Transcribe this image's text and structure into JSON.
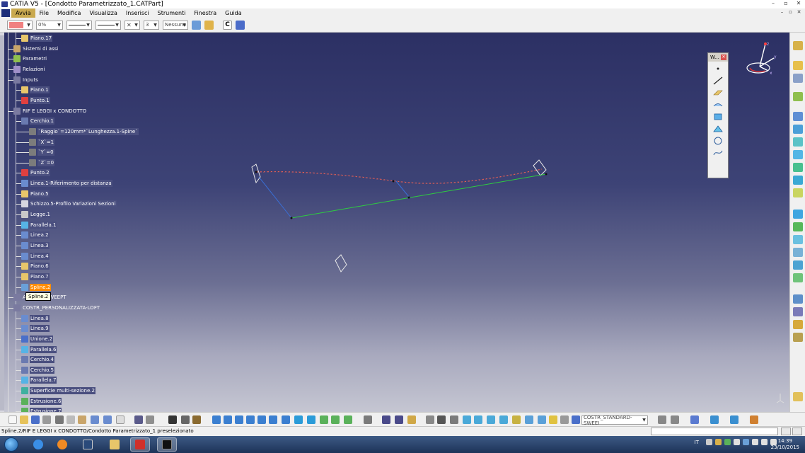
{
  "window": {
    "title": "CATIA V5 - [Condotto Parametrizzato_1.CATPart]",
    "buttons": [
      "–",
      "▫",
      "✕"
    ],
    "mdi_buttons": [
      "–",
      "▫",
      "✕"
    ]
  },
  "menu": {
    "items": [
      "Avvia",
      "File",
      "Modifica",
      "Visualizza",
      "Inserisci",
      "Strumenti",
      "Finestra",
      "Guida"
    ]
  },
  "properties_toolbar": {
    "transparency": "0%",
    "line_weight": "3",
    "layer": "Nessuno",
    "color_hex": "#f08080"
  },
  "tree": {
    "items": [
      {
        "label": "Piano.17",
        "icon": "plane-icon"
      },
      {
        "label": "Sistemi di assi",
        "icon": "axis-system-icon"
      },
      {
        "label": "Parametri",
        "icon": "parameters-icon"
      },
      {
        "label": "Relazioni",
        "icon": "relations-icon"
      },
      {
        "label": "Inputs",
        "icon": "geometrical-set-icon"
      },
      {
        "label": "Piano.1",
        "icon": "plane-icon"
      },
      {
        "label": "Punto.1",
        "icon": "point-icon"
      },
      {
        "label": "RIF E LEGGI x CONDOTTO",
        "icon": "geometrical-set-icon"
      },
      {
        "label": "Cerchio.1",
        "icon": "circle-icon"
      },
      {
        "label": "`Raggio`=120mm*`Lunghezza.1-Spine`",
        "icon": "formula-icon"
      },
      {
        "label": "`X`=1",
        "icon": "formula-icon"
      },
      {
        "label": "`Y`=0",
        "icon": "formula-icon"
      },
      {
        "label": "`Z`=0",
        "icon": "formula-icon"
      },
      {
        "label": "Punto.2",
        "icon": "point-icon"
      },
      {
        "label": "Linea.1-Riferimento per distanza",
        "icon": "line-icon"
      },
      {
        "label": "Piano.5",
        "icon": "plane-icon"
      },
      {
        "label": "Schizzo.5-Profilo Variazioni Sezioni",
        "icon": "sketch-icon"
      },
      {
        "label": "Legge.1",
        "icon": "law-icon"
      },
      {
        "label": "Parallela.1",
        "icon": "parallel-curve-icon"
      },
      {
        "label": "Linea.2",
        "icon": "line-icon"
      },
      {
        "label": "Linea.3",
        "icon": "line-icon"
      },
      {
        "label": "Linea.4",
        "icon": "line-icon"
      },
      {
        "label": "Piano.6",
        "icon": "plane-icon"
      },
      {
        "label": "Piano.7",
        "icon": "plane-icon"
      },
      {
        "label": "Spline.2",
        "icon": "spline-icon"
      },
      {
        "label": "ANDARD-SWEEPT",
        "icon": "geometrical-set-icon"
      },
      {
        "label": "COSTR_PERSONALIZZATA-LOFT",
        "icon": "geometrical-set-icon"
      },
      {
        "label": "Linea.8",
        "icon": "line-icon"
      },
      {
        "label": "Linea.9",
        "icon": "line-icon"
      },
      {
        "label": "Unione.2",
        "icon": "join-icon"
      },
      {
        "label": "Parallela.6",
        "icon": "parallel-curve-icon"
      },
      {
        "label": "Cerchio.4",
        "icon": "circle-icon"
      },
      {
        "label": "Cerchio.5",
        "icon": "circle-icon"
      },
      {
        "label": "Parallela.7",
        "icon": "parallel-curve-icon"
      },
      {
        "label": "Superficie multi-sezione.2",
        "icon": "multi-section-surface-icon"
      },
      {
        "label": "Estrusione.6",
        "icon": "extrude-icon"
      },
      {
        "label": "Estrusione.7",
        "icon": "extrude-icon"
      }
    ],
    "tooltip": "Spline.2"
  },
  "floating_toolbar": {
    "title": "W..."
  },
  "compass": {
    "axes": [
      "x",
      "y",
      "z"
    ]
  },
  "bottom_toolbar": {
    "current_set": "COSTR_STANDARD-SWEEI"
  },
  "status_bar": {
    "message": "Spline.2/RIF E LEGGI x CONDOTTO/Condotto Parametrizzato_1 preselezionato"
  },
  "taskbar": {
    "language": "IT",
    "time": "14:39",
    "date": "23/10/2015",
    "apps": [
      "start-orb",
      "ie-icon",
      "media-player-icon",
      "desktop-icon",
      "explorer-icon",
      "autocad-icon",
      "catia-icon"
    ]
  },
  "colors": {
    "viewport_top": "#2c3064",
    "viewport_bottom": "#c5c6d2",
    "selection": "#ff8c00",
    "spline": "#d95b5b",
    "green_line": "#2ecc40",
    "blue_line": "#3a6fd6"
  }
}
